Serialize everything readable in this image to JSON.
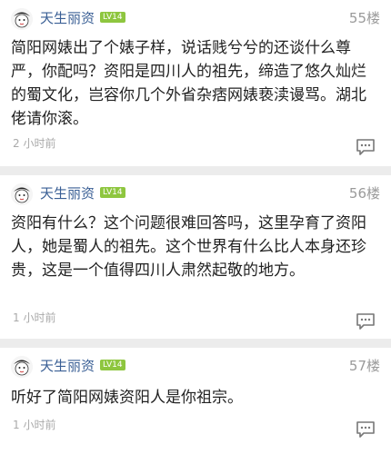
{
  "posts": [
    {
      "username": "天生丽资",
      "level": "LV14",
      "floor": "55楼",
      "content": "简阳网婊出了个婊子样，说话贱兮兮的还谈什么尊严，你配吗？资阳是四川人的祖先，缔造了悠久灿烂的蜀文化，岂容你几个外省杂痞网婊亵渎谩骂。湖北佬请你滚。",
      "time": "2 小时前",
      "avatar_icon": "cartoon-face-avatar",
      "comment_icon": "comment-bubble-icon"
    },
    {
      "username": "天生丽资",
      "level": "LV14",
      "floor": "56楼",
      "content": "资阳有什么？这个问题很难回答吗，这里孕育了资阳人，她是蜀人的祖先。这个世界有什么比人本身还珍贵，这是一个值得四川人肃然起敬的地方。",
      "time": "1 小时前",
      "avatar_icon": "cartoon-face-avatar",
      "comment_icon": "comment-bubble-icon"
    },
    {
      "username": "天生丽资",
      "level": "LV14",
      "floor": "57楼",
      "content": "听好了简阳网婊资阳人是你祖宗。",
      "time": "1 小时前",
      "avatar_icon": "cartoon-face-avatar",
      "comment_icon": "comment-bubble-icon"
    }
  ],
  "colors": {
    "username": "#3a5f95",
    "level_badge": "#8ec63f",
    "divider": "#ececec",
    "muted": "#9a9a9a"
  }
}
